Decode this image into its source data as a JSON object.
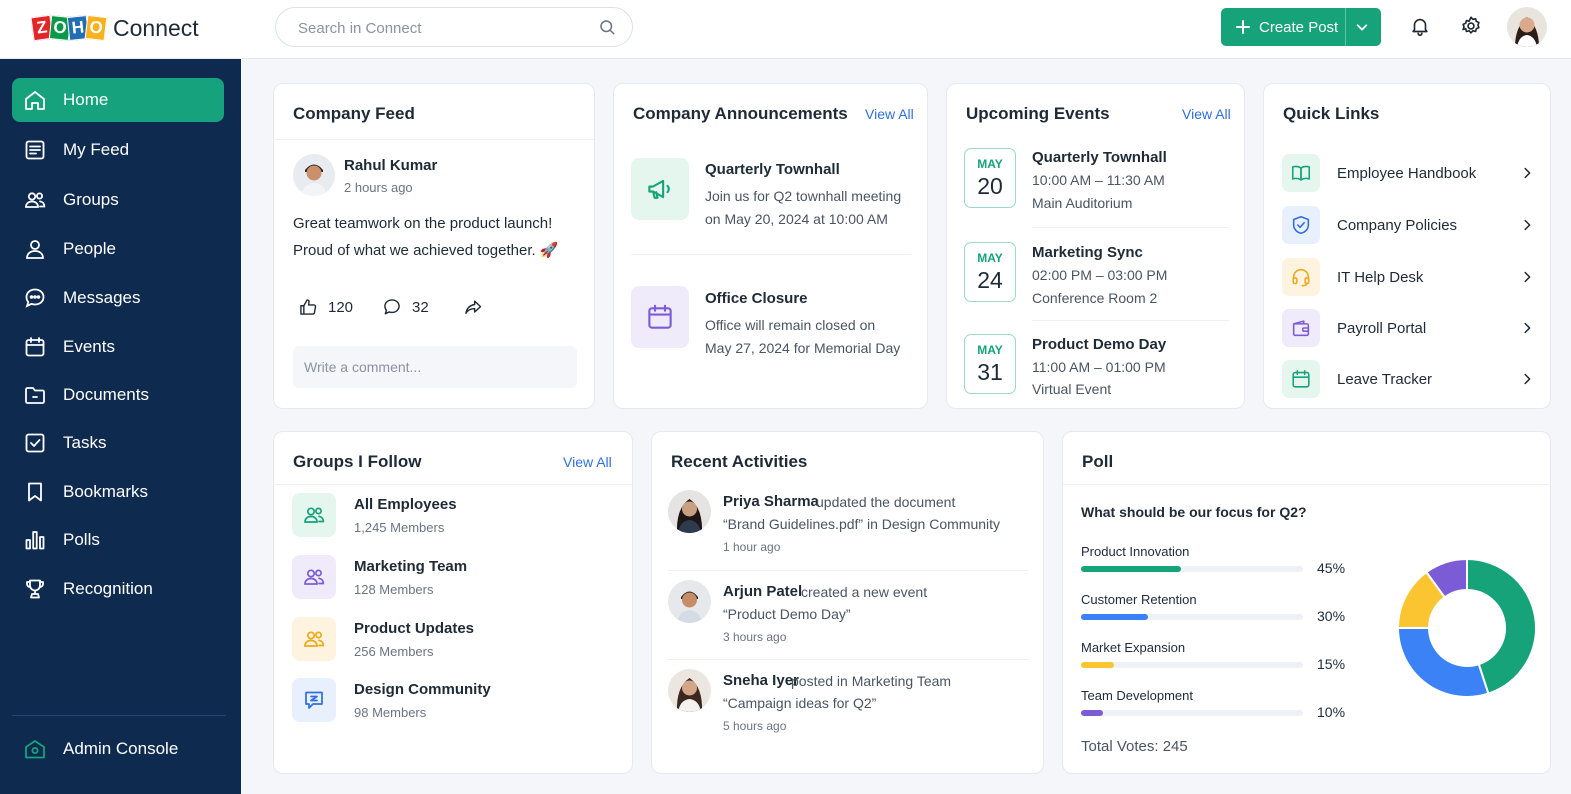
{
  "app": {
    "logo_letters": [
      "Z",
      "O",
      "H",
      "O"
    ],
    "name": "Connect"
  },
  "search": {
    "placeholder": "Search in Connect"
  },
  "header": {
    "create_label": "Create Post"
  },
  "sidebar": {
    "items": [
      {
        "label": "Home",
        "icon": "home-icon",
        "active": true
      },
      {
        "label": "My Feed",
        "icon": "feed-icon"
      },
      {
        "label": "Groups",
        "icon": "groups-icon"
      },
      {
        "label": "People",
        "icon": "person-icon"
      },
      {
        "label": "Messages",
        "icon": "chat-icon"
      },
      {
        "label": "Events",
        "icon": "calendar-icon"
      },
      {
        "label": "Documents",
        "icon": "folder-icon"
      },
      {
        "label": "Tasks",
        "icon": "checkbox-icon"
      },
      {
        "label": "Bookmarks",
        "icon": "bookmark-icon"
      },
      {
        "label": "Polls",
        "icon": "bar-chart-icon"
      },
      {
        "label": "Recognition",
        "icon": "trophy-icon"
      }
    ],
    "admin_label": "Admin Console"
  },
  "feed": {
    "title": "Company Feed",
    "author": "Rahul Kumar",
    "time": "2 hours ago",
    "text_line1": "Great teamwork on the product launch!",
    "text_line2": "Proud of what we achieved together. 🚀",
    "likes": "120",
    "comments": "32",
    "comment_placeholder": "Write a comment..."
  },
  "announcements": {
    "title": "Company Announcements",
    "view_all": "View All",
    "items": [
      {
        "title": "Quarterly Townhall",
        "line1": "Join us for Q2 townhall meeting",
        "line2": "on May 20, 2024 at 10:00 AM",
        "icon": "megaphone-icon"
      },
      {
        "title": "Office Closure",
        "line1": "Office will remain closed on",
        "line2": "May 27, 2024 for Memorial Day",
        "icon": "calendar-icon"
      }
    ]
  },
  "events": {
    "title": "Upcoming Events",
    "view_all": "View All",
    "items": [
      {
        "month": "MAY",
        "day": "20",
        "title": "Quarterly Townhall",
        "time": "10:00 AM – 11:30 AM",
        "place": "Main Auditorium"
      },
      {
        "month": "MAY",
        "day": "24",
        "title": "Marketing Sync",
        "time": "02:00 PM – 03:00 PM",
        "place": "Conference Room 2"
      },
      {
        "month": "MAY",
        "day": "31",
        "title": "Product Demo Day",
        "time": "11:00 AM – 01:00 PM",
        "place": "Virtual Event"
      }
    ]
  },
  "quick_links": {
    "title": "Quick Links",
    "items": [
      {
        "label": "Employee Handbook",
        "icon": "book-icon",
        "color": "#16a37a"
      },
      {
        "label": "Company Policies",
        "icon": "shield-icon",
        "color": "#2f6fde"
      },
      {
        "label": "IT Help Desk",
        "icon": "headset-icon",
        "color": "#f0a81c"
      },
      {
        "label": "Payroll Portal",
        "icon": "wallet-icon",
        "color": "#7c5cd6"
      },
      {
        "label": "Leave Tracker",
        "icon": "calendar-icon",
        "color": "#16a37a"
      }
    ]
  },
  "groups": {
    "title": "Groups I Follow",
    "view_all": "View All",
    "items": [
      {
        "name": "All Employees",
        "members": "1,245 Members",
        "icon": "groups-icon"
      },
      {
        "name": "Marketing Team",
        "members": "128 Members",
        "icon": "groups-icon"
      },
      {
        "name": "Product Updates",
        "members": "256 Members",
        "icon": "groups-icon"
      },
      {
        "name": "Design Community",
        "members": "98 Members",
        "icon": "design-chat-icon"
      }
    ]
  },
  "activities": {
    "title": "Recent Activities",
    "items": [
      {
        "name": "Priya Sharma",
        "action": "updated the document",
        "detail": "“Brand Guidelines.pdf” in Design Community",
        "time": "1 hour ago"
      },
      {
        "name": "Arjun Patel",
        "action": "created a new event",
        "detail": "“Product Demo Day”",
        "time": "3 hours ago"
      },
      {
        "name": "Sneha Iyer",
        "action": "posted in Marketing Team",
        "detail": "“Campaign ideas for Q2”",
        "time": "5 hours ago"
      }
    ]
  },
  "poll": {
    "title": "Poll",
    "question": "What should be our focus for Q2?",
    "options": [
      {
        "label": "Product Innovation",
        "pct_label": "45%",
        "value": 45,
        "color": "#16a37a"
      },
      {
        "label": "Customer Retention",
        "pct_label": "30%",
        "value": 30,
        "color": "#3b82f6"
      },
      {
        "label": "Market Expansion",
        "pct_label": "15%",
        "value": 15,
        "color": "#fbc531"
      },
      {
        "label": "Team Development",
        "pct_label": "10%",
        "value": 10,
        "color": "#7c5cd6"
      }
    ],
    "total": "Total Votes: 245"
  }
}
